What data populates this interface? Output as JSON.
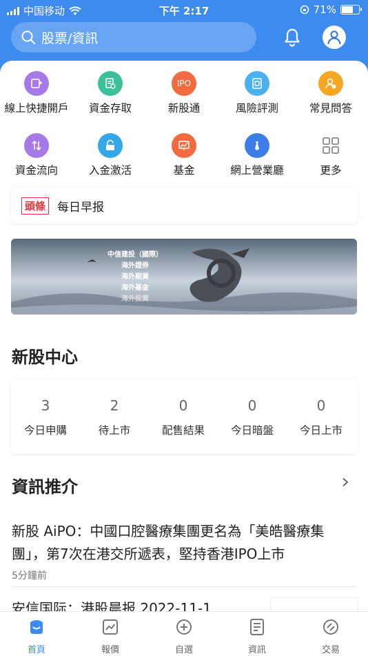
{
  "status_bar": {
    "carrier": "中国移动",
    "time": "下午 2:17",
    "battery": "71%",
    "battery_level": 0.71
  },
  "search": {
    "placeholder": "股票/資訊"
  },
  "quick_actions": [
    {
      "label": "線上快捷開戶",
      "icon": "open-account-icon",
      "color": "#a679e8"
    },
    {
      "label": "資金存取",
      "icon": "fund-access-icon",
      "color": "#3dbf9c"
    },
    {
      "label": "新股通",
      "icon": "ipo-icon",
      "color": "#f26a3f",
      "icon_text": "IPO"
    },
    {
      "label": "風險評測",
      "icon": "risk-assessment-icon",
      "color": "#4bb0ee"
    },
    {
      "label": "常見問答",
      "icon": "faq-icon",
      "color": "#f5a623"
    },
    {
      "label": "資金流向",
      "icon": "fund-flow-icon",
      "color": "#a679e8"
    },
    {
      "label": "入金激活",
      "icon": "deposit-activate-icon",
      "color": "#35a7e6"
    },
    {
      "label": "基金",
      "icon": "fund-chart-icon",
      "color": "#f26a3f"
    },
    {
      "label": "網上營業廳",
      "icon": "online-hall-icon",
      "color": "#3d7de8"
    },
    {
      "label": "更多",
      "icon": "more-grid-icon",
      "color": "#888888"
    }
  ],
  "headline": {
    "tag": "頭條",
    "text": "每日早报"
  },
  "banner": {
    "lines": [
      "中信建投（國際）",
      "海外證券",
      "海外期貨",
      "海外基金",
      "海外投資"
    ]
  },
  "ipo_center": {
    "title": "新股中心",
    "stats": [
      {
        "value": "3",
        "label": "今日申購"
      },
      {
        "value": "2",
        "label": "待上市"
      },
      {
        "value": "0",
        "label": "配售結果"
      },
      {
        "value": "0",
        "label": "今日暗盤"
      },
      {
        "value": "0",
        "label": "今日上市"
      }
    ]
  },
  "news": {
    "title": "資訊推介",
    "items": [
      {
        "title_line1": "新股 AiPO：中國口腔醫療集團更名為「美皓醫療集",
        "title_line2": "團」，第7次在港交所遞表，堅持香港IPO上市",
        "time": "5分鐘前"
      },
      {
        "title_line1": "安信国际：港股晨报 2022-11-1"
      }
    ]
  },
  "tabbar": [
    {
      "label": "首頁",
      "icon": "home-icon",
      "active": true
    },
    {
      "label": "報價",
      "icon": "quote-chart-icon",
      "active": false
    },
    {
      "label": "自選",
      "icon": "add-watchlist-icon",
      "active": false
    },
    {
      "label": "資訊",
      "icon": "news-doc-icon",
      "active": false
    },
    {
      "label": "交易",
      "icon": "trade-icon",
      "active": false
    }
  ],
  "colors": {
    "brand": "#3d8bef",
    "headline_red": "#e2323a"
  }
}
